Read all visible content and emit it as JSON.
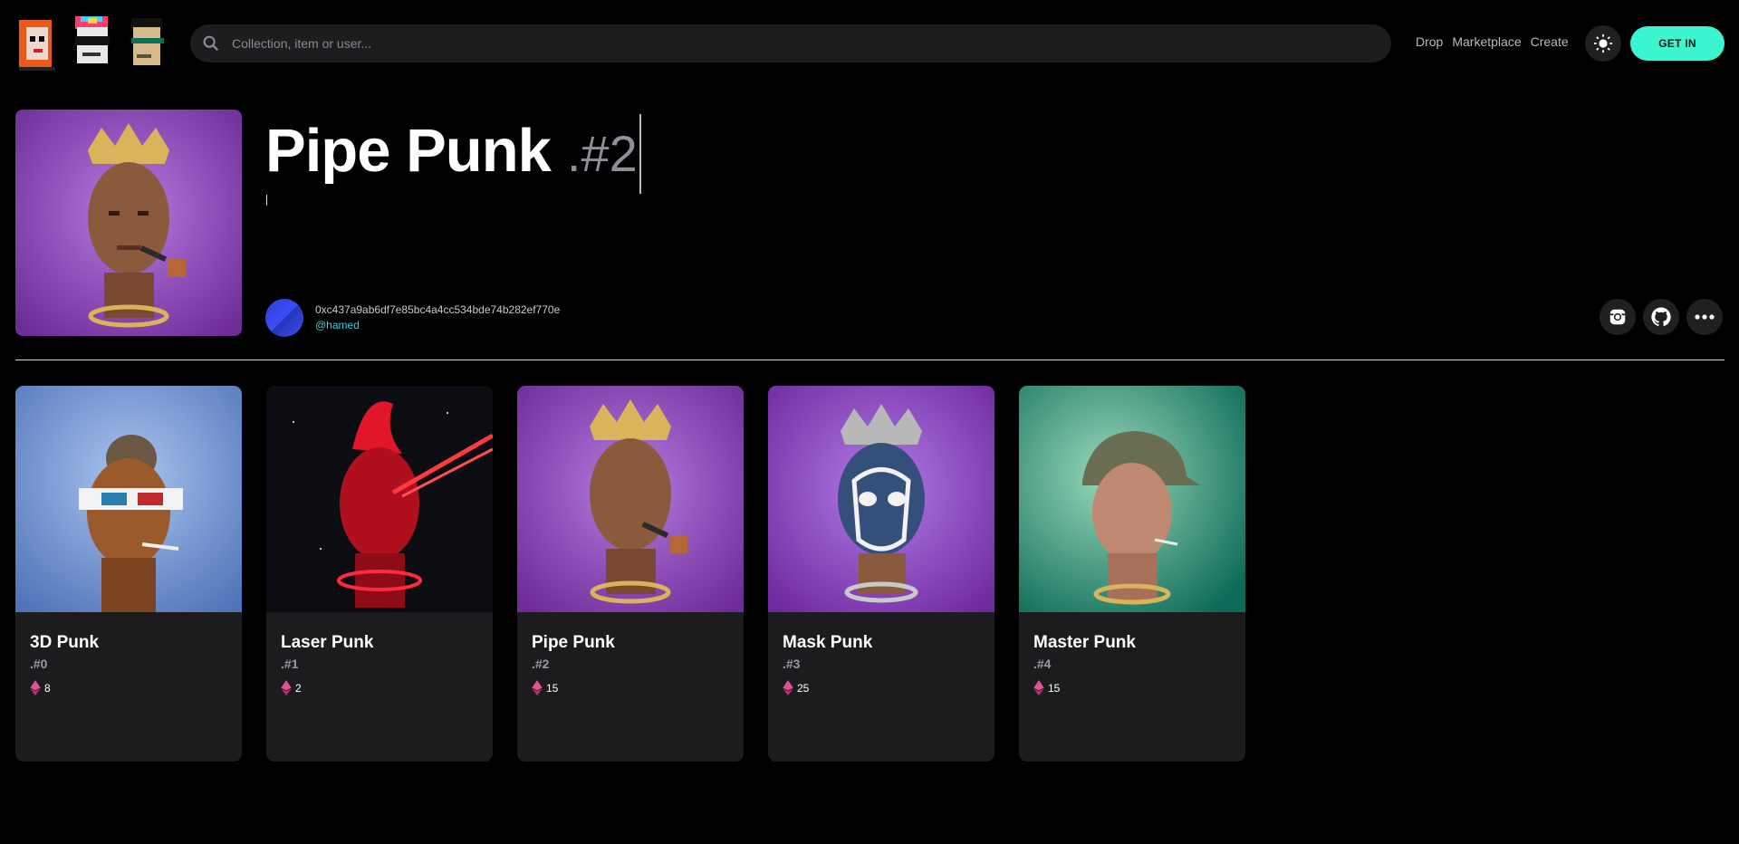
{
  "header": {
    "logo_icon": "pixel-punk-avatars-logo",
    "search_placeholder": "Collection, item or user...",
    "nav": [
      "Drop",
      "Marketplace",
      "Create"
    ],
    "theme_icon": "sun-icon",
    "cta_label": "GET IN"
  },
  "item": {
    "name": "Pipe Punk",
    "number": ".#2",
    "owner_address": "0xc437a9ab6df7e85bc4a4cc534bde74b282ef770e",
    "owner_handle": "@hamed",
    "social_icons": [
      "instagram-icon",
      "github-icon",
      "more-icon"
    ]
  },
  "cards": [
    {
      "title": "3D Punk",
      "number": ".#0",
      "price": "8",
      "bg": "#7fa0d8"
    },
    {
      "title": "Laser Punk",
      "number": ".#1",
      "price": "2",
      "bg": "#0b0d12"
    },
    {
      "title": "Pipe Punk",
      "number": ".#2",
      "price": "15",
      "bg": "#8a4ab8"
    },
    {
      "title": "Mask Punk",
      "number": ".#3",
      "price": "25",
      "bg": "#8e46c2"
    },
    {
      "title": "Master Punk",
      "number": ".#4",
      "price": "15",
      "bg": "#2f8d74"
    }
  ],
  "colors": {
    "accent": "#3ef5d1",
    "handle": "#27d3e8",
    "card_bg": "#1c1c1f",
    "price_gem": "#e44f95"
  }
}
